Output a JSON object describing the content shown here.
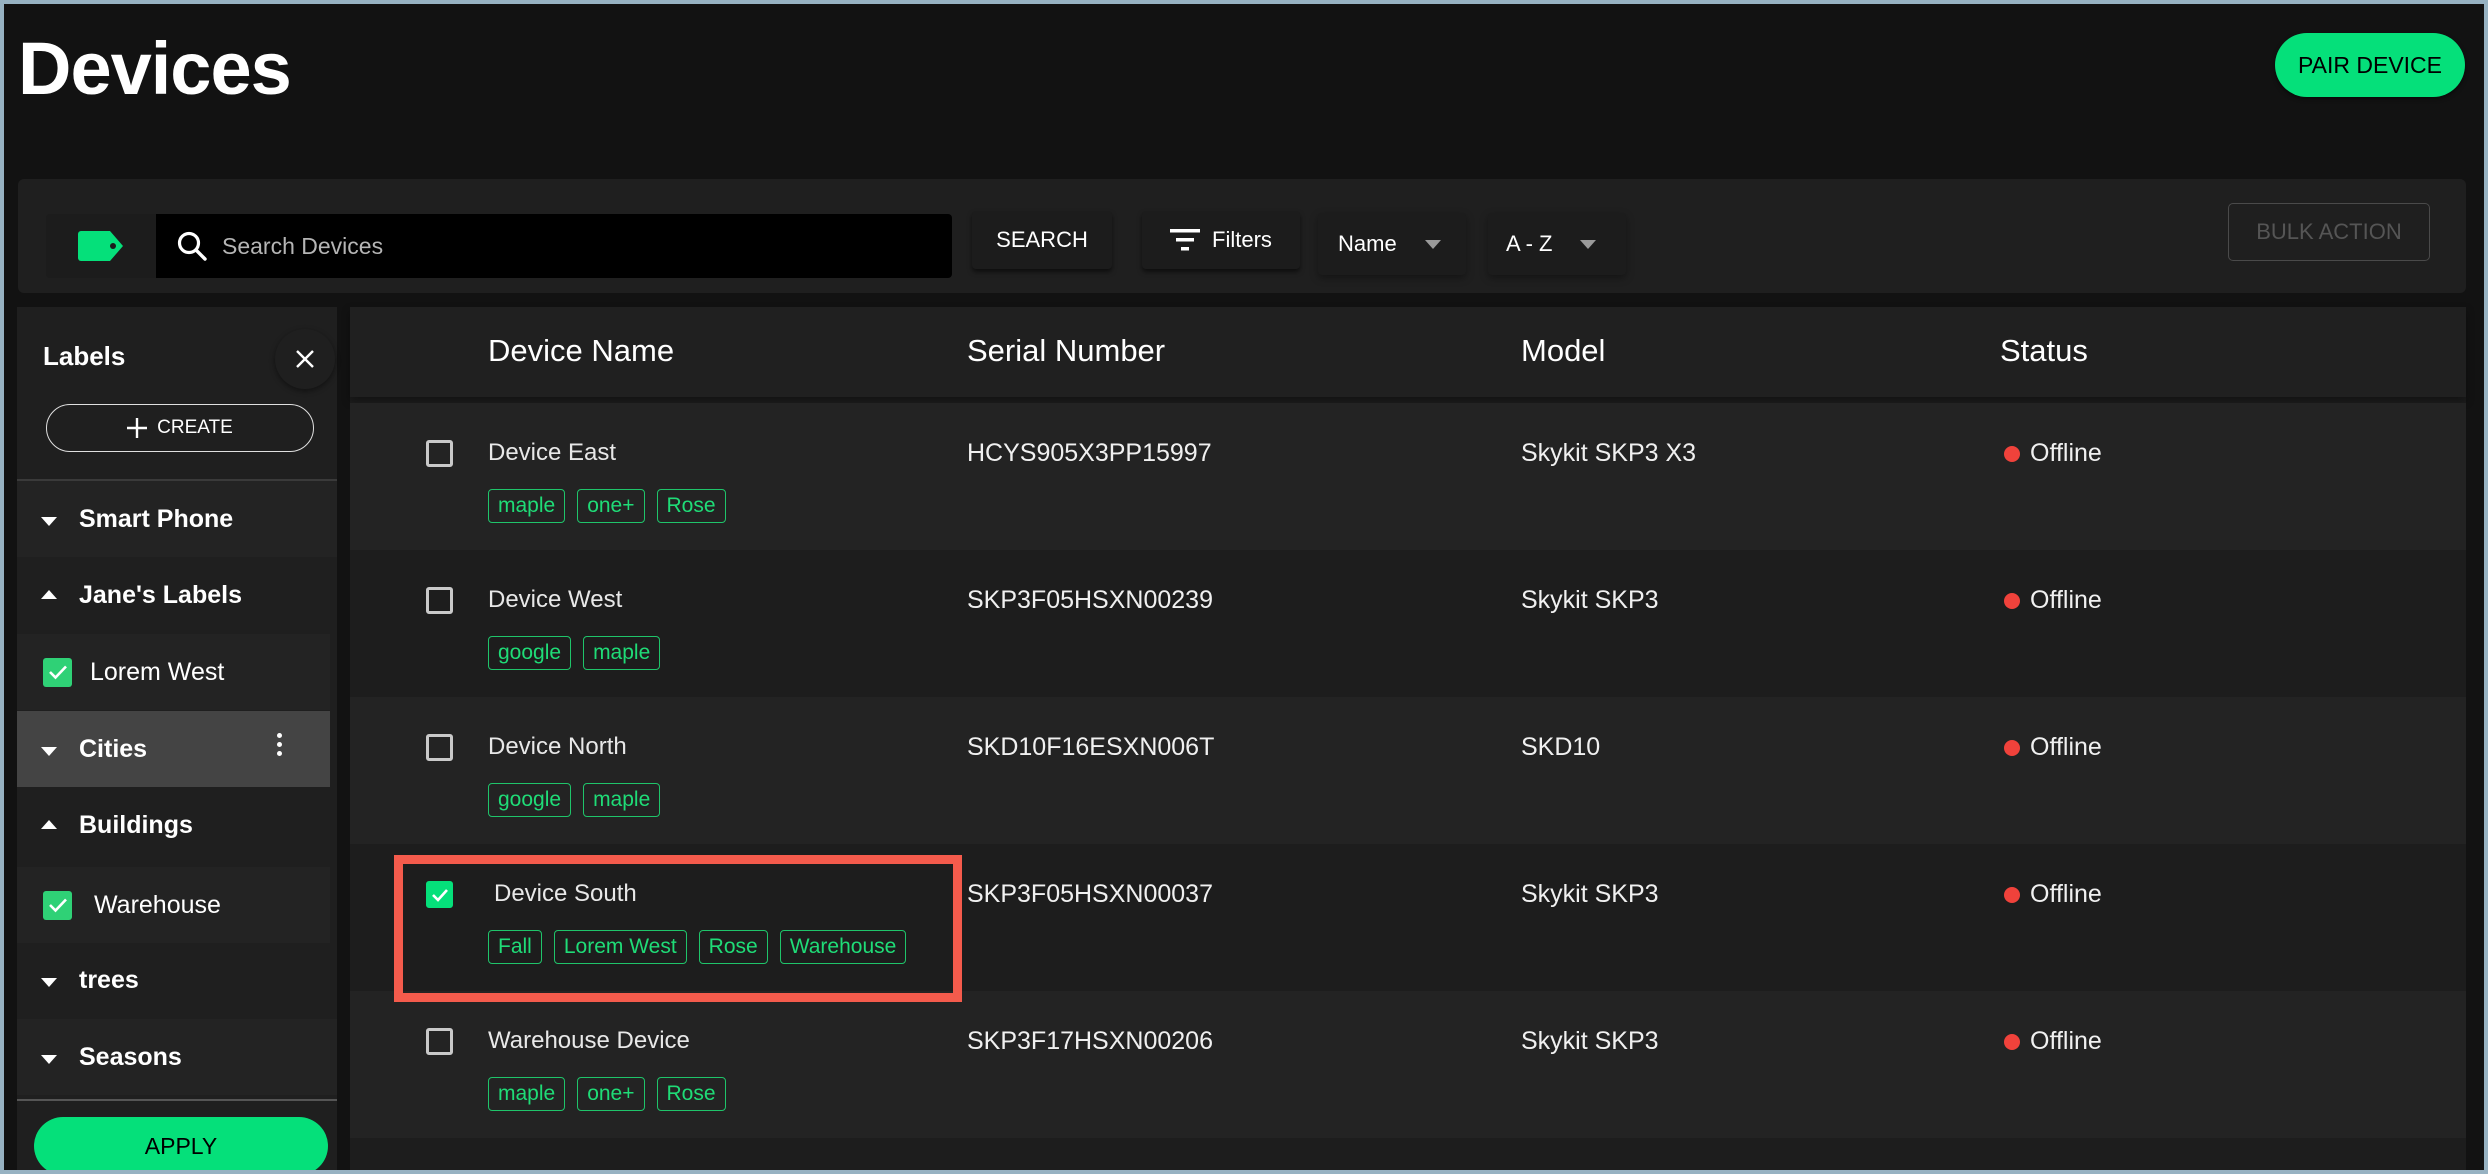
{
  "header": {
    "title": "Devices",
    "pair_device_label": "PAIR DEVICE"
  },
  "toolbar": {
    "tag_icon": "label-tag-icon",
    "search_placeholder": "Search Devices",
    "search_value": "",
    "search_label": "SEARCH",
    "filters_label": "Filters",
    "sort_field": "Name",
    "sort_order": "A - Z",
    "bulk_action_label": "BULK ACTION"
  },
  "sidebar": {
    "title": "Labels",
    "create_label": "CREATE",
    "apply_label": "APPLY",
    "groups": [
      {
        "name": "Smart Phone",
        "expanded": false,
        "items": []
      },
      {
        "name": "Jane's Labels",
        "expanded": true,
        "items": [
          {
            "label": "Lorem West",
            "checked": true
          }
        ]
      },
      {
        "name": "Cities",
        "expanded": false,
        "highlighted": true,
        "items": []
      },
      {
        "name": "Buildings",
        "expanded": true,
        "items": [
          {
            "label": "Warehouse",
            "checked": true
          }
        ]
      },
      {
        "name": "trees",
        "expanded": false,
        "items": []
      },
      {
        "name": "Seasons",
        "expanded": false,
        "items": []
      }
    ]
  },
  "table": {
    "columns": [
      "Device Name",
      "Serial Number",
      "Model",
      "Status"
    ],
    "rows": [
      {
        "name": "Device East",
        "serial": "HCYS905X3PP15997",
        "model": "Skykit SKP3 X3",
        "status": "Offline",
        "selected": false,
        "tags": [
          "maple",
          "one+",
          "Rose"
        ]
      },
      {
        "name": "Device West",
        "serial": "SKP3F05HSXN00239",
        "model": "Skykit SKP3",
        "status": "Offline",
        "selected": false,
        "tags": [
          "google",
          "maple"
        ]
      },
      {
        "name": "Device North",
        "serial": "SKD10F16ESXN006T",
        "model": "SKD10",
        "status": "Offline",
        "selected": false,
        "tags": [
          "google",
          "maple"
        ]
      },
      {
        "name": "Device South",
        "serial": "SKP3F05HSXN00037",
        "model": "Skykit SKP3",
        "status": "Offline",
        "selected": true,
        "tags": [
          "Fall",
          "Lorem West",
          "Rose",
          "Warehouse"
        ]
      },
      {
        "name": "Warehouse Device",
        "serial": "SKP3F17HSXN00206",
        "model": "Skykit SKP3",
        "status": "Offline",
        "selected": false,
        "tags": [
          "maple",
          "one+",
          "Rose"
        ]
      }
    ]
  },
  "colors": {
    "accent": "#05e07a",
    "tag": "#1fdc77",
    "offline": "#f0423b",
    "highlight": "#f45b4c",
    "background": "#121212"
  }
}
